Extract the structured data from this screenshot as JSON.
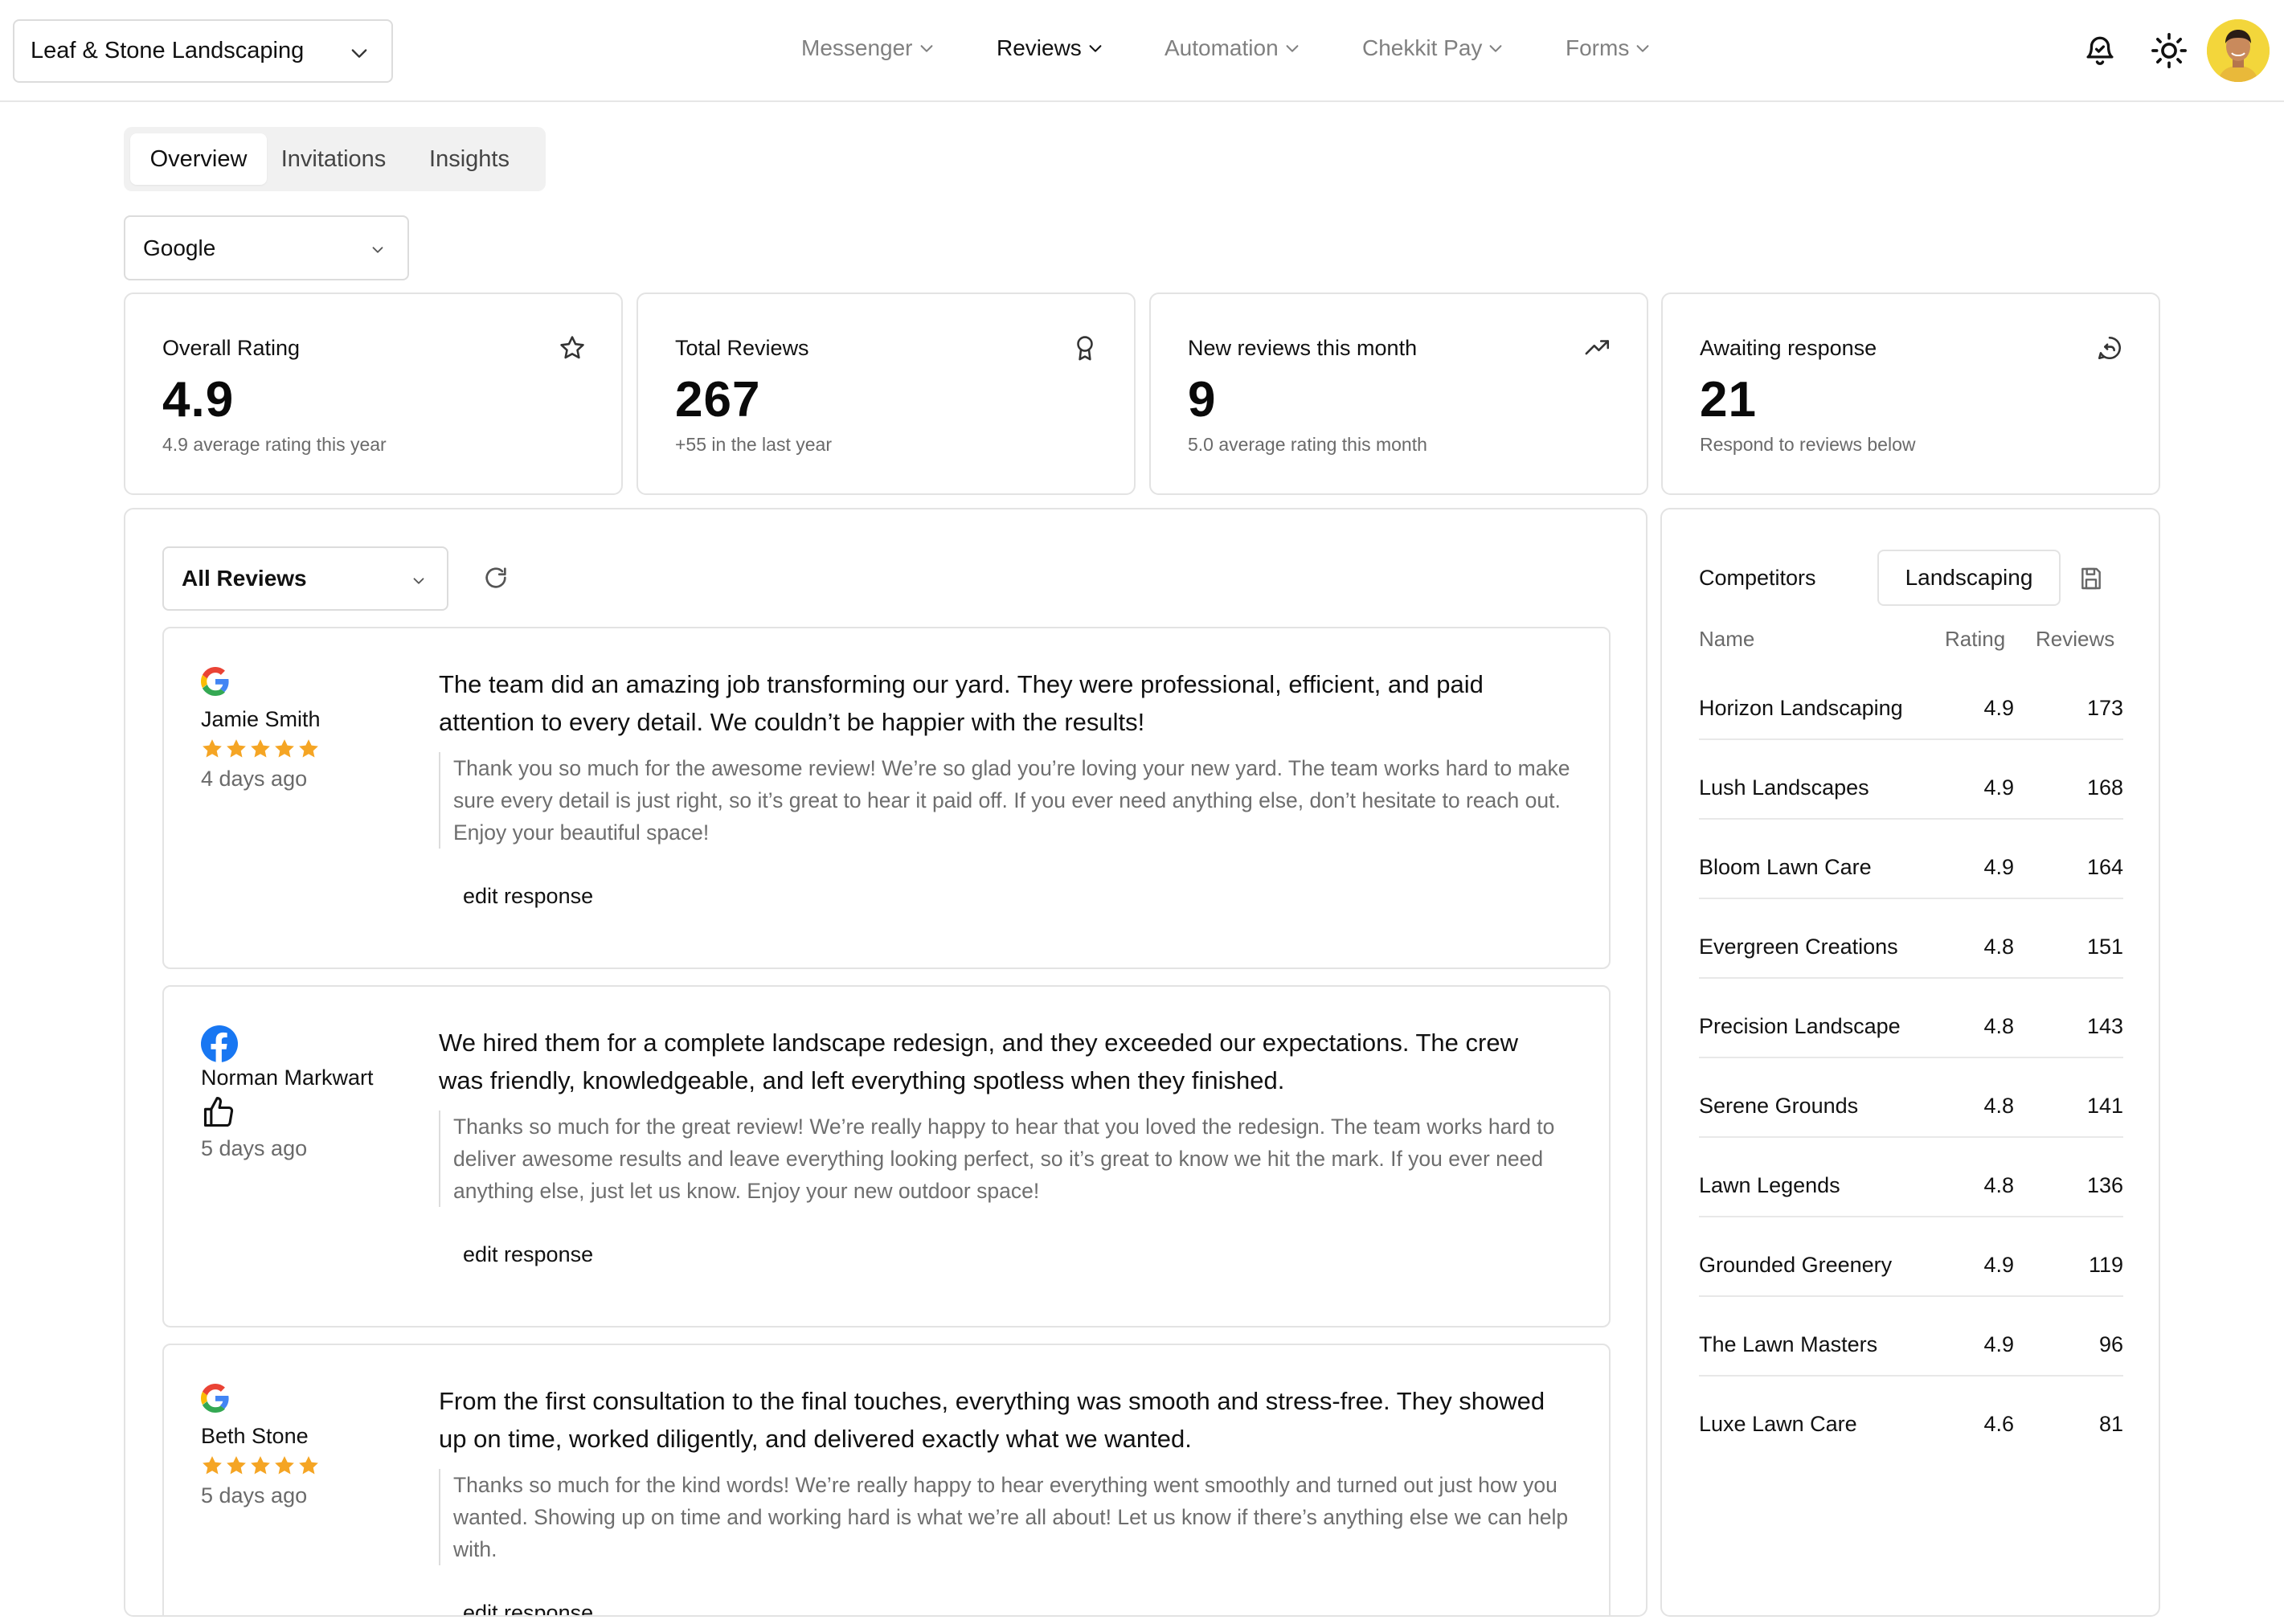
{
  "header": {
    "business_name": "Leaf & Stone Landscaping",
    "nav": [
      {
        "label": "Messenger",
        "active": false
      },
      {
        "label": "Reviews",
        "active": true
      },
      {
        "label": "Automation",
        "active": false
      },
      {
        "label": "Chekkit Pay",
        "active": false
      },
      {
        "label": "Forms",
        "active": false
      }
    ],
    "icons": [
      "bell-icon",
      "sun-icon",
      "avatar"
    ]
  },
  "tabs": [
    {
      "label": "Overview",
      "active": true
    },
    {
      "label": "Invitations",
      "active": false
    },
    {
      "label": "Insights",
      "active": false
    }
  ],
  "source_filter": {
    "value": "Google"
  },
  "stats": [
    {
      "label": "Overall Rating",
      "value": "4.9",
      "sub": "4.9 average rating this year",
      "icon": "star-icon"
    },
    {
      "label": "Total Reviews",
      "value": "267",
      "sub": "+55 in the last year",
      "icon": "award-icon"
    },
    {
      "label": "New reviews this month",
      "value": "9",
      "sub": "5.0 average rating this month",
      "icon": "trending-up-icon"
    },
    {
      "label": "Awaiting response",
      "value": "21",
      "sub": "Respond to reviews below",
      "icon": "message-reply-icon"
    }
  ],
  "reviews_filter": {
    "value": "All Reviews"
  },
  "reviews": [
    {
      "source": "google",
      "author": "Jamie Smith",
      "rating": 5,
      "date": "4 days ago",
      "text": "The team did an amazing job transforming our yard. They were professional, efficient, and paid attention to every detail. We couldn’t be happier with the results!",
      "reply": "Thank you so much for the awesome review! We’re so glad you’re loving your new yard. The team works hard to make sure every detail is just right, so it’s great to hear it paid off. If you ever need anything else, don’t hesitate to reach out. Enjoy your beautiful space!",
      "edit_label": "edit response"
    },
    {
      "source": "facebook",
      "author": "Norman Markwart",
      "rating": "recommended",
      "date": "5 days ago",
      "text": "We hired them for a complete landscape redesign, and they exceeded our expectations. The crew was friendly, knowledgeable, and left everything spotless when they finished.",
      "reply": "Thanks so much for the great review! We’re really happy to hear that you loved the redesign. The team works hard to deliver awesome results and leave everything looking perfect, so it’s great to know we hit the mark. If you ever need anything else, just let us know. Enjoy your new outdoor space!",
      "edit_label": "edit response"
    },
    {
      "source": "google",
      "author": "Beth Stone",
      "rating": 5,
      "date": "5 days ago",
      "text": "From the first consultation to the final touches, everything was smooth and stress-free. They showed up on time, worked diligently, and delivered exactly what we wanted.",
      "reply": "Thanks so much for the kind words! We’re really happy to hear everything went smoothly and turned out just how you wanted. Showing up on time and working hard is what we’re all about! Let us know if there’s anything else we can help with.",
      "edit_label": "edit response"
    }
  ],
  "competitors": {
    "title": "Competitors",
    "category": "Landscaping",
    "columns": {
      "name": "Name",
      "rating": "Rating",
      "reviews": "Reviews"
    },
    "rows": [
      {
        "name": "Horizon Landscaping",
        "rating": "4.9",
        "reviews": "173"
      },
      {
        "name": "Lush Landscapes",
        "rating": "4.9",
        "reviews": "168"
      },
      {
        "name": "Bloom Lawn Care",
        "rating": "4.9",
        "reviews": "164"
      },
      {
        "name": "Evergreen Creations",
        "rating": "4.8",
        "reviews": "151"
      },
      {
        "name": "Precision Landscape",
        "rating": "4.8",
        "reviews": "143"
      },
      {
        "name": "Serene Grounds",
        "rating": "4.8",
        "reviews": "141"
      },
      {
        "name": "Lawn Legends",
        "rating": "4.8",
        "reviews": "136"
      },
      {
        "name": "Grounded Greenery",
        "rating": "4.9",
        "reviews": "119"
      },
      {
        "name": "The Lawn Masters",
        "rating": "4.9",
        "reviews": "96"
      },
      {
        "name": "Luxe Lawn Care",
        "rating": "4.6",
        "reviews": "81"
      }
    ]
  },
  "colors": {
    "star": "#f5a524",
    "facebook": "#1877f2",
    "google_blue": "#4285f4",
    "google_red": "#ea4335",
    "google_yellow": "#fbbc05",
    "google_green": "#34a853",
    "border": "#e3e3e3",
    "muted_text": "#6a6a6a"
  }
}
